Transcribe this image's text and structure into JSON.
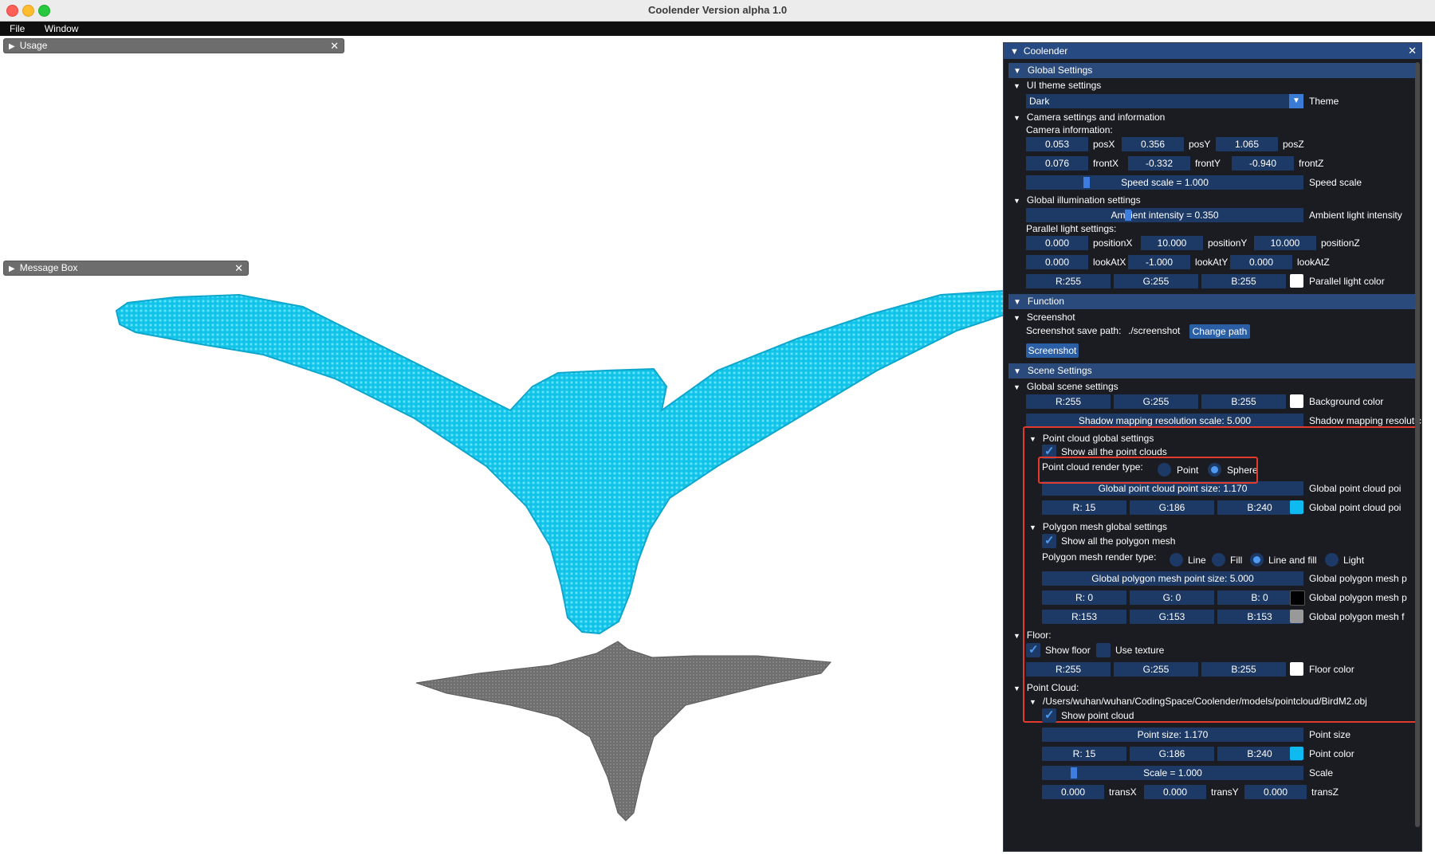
{
  "window": {
    "title": "Coolender Version alpha 1.0"
  },
  "menu": [
    "File",
    "Window"
  ],
  "usage_window": {
    "title": "Usage"
  },
  "message_box": {
    "title": "Message Box"
  },
  "panel": {
    "title": "Coolender",
    "global_settings": {
      "header": "Global Settings",
      "ui_theme": {
        "title": "UI theme settings",
        "value": "Dark",
        "label": "Theme"
      },
      "camera": {
        "title": "Camera settings and information",
        "info_label": "Camera information:",
        "pos": [
          {
            "value": "0.053",
            "label": "posX"
          },
          {
            "value": "0.356",
            "label": "posY"
          },
          {
            "value": "1.065",
            "label": "posZ"
          }
        ],
        "front": [
          {
            "value": "0.076",
            "label": "frontX"
          },
          {
            "value": "-0.332",
            "label": "frontY"
          },
          {
            "value": "-0.940",
            "label": "frontZ"
          }
        ],
        "speed": {
          "value": "Speed scale = 1.000",
          "label": "Speed scale"
        }
      },
      "illumination": {
        "title": "Global illumination settings",
        "ambient": {
          "value": "Ambient intensity = 0.350",
          "label": "Ambient light intensity"
        },
        "parallel_label": "Parallel light settings:",
        "position": [
          {
            "value": "0.000",
            "label": "positionX"
          },
          {
            "value": "10.000",
            "label": "positionY"
          },
          {
            "value": "10.000",
            "label": "positionZ"
          }
        ],
        "lookat": [
          {
            "value": "0.000",
            "label": "lookAtX"
          },
          {
            "value": "-1.000",
            "label": "lookAtY"
          },
          {
            "value": "0.000",
            "label": "lookAtZ"
          }
        ],
        "color": {
          "r": "R:255",
          "g": "G:255",
          "b": "B:255",
          "label": "Parallel light color",
          "swatch": "#ffffff"
        }
      }
    },
    "function": {
      "header": "Function",
      "screenshot_title": "Screenshot",
      "save_path_label": "Screenshot save path:",
      "save_path_value": "./screenshot",
      "change_path": "Change path",
      "screenshot_btn": "Screenshot"
    },
    "scene": {
      "header": "Scene Settings",
      "global_title": "Global scene settings",
      "bg": {
        "r": "R:255",
        "g": "G:255",
        "b": "B:255",
        "label": "Background color",
        "swatch": "#ffffff"
      },
      "shadow": {
        "value": "Shadow mapping resolution scale: 5.000",
        "label": "Shadow mapping resolutic"
      },
      "pc_global": {
        "title": "Point cloud global settings",
        "show_all": "Show all the point clouds",
        "render_type_label": "Point cloud render type:",
        "point": "Point",
        "sphere": "Sphere",
        "size": {
          "value": "Global point cloud point size: 1.170",
          "label": "Global point cloud poi"
        },
        "color": {
          "r": "R: 15",
          "g": "G:186",
          "b": "B:240",
          "label": "Global point cloud poi",
          "swatch": "#0fbaf0"
        }
      },
      "mesh_global": {
        "title": "Polygon mesh global settings",
        "show_all": "Show all the polygon mesh",
        "render_type_label": "Polygon mesh render type:",
        "types": [
          "Line",
          "Fill",
          "Line and fill",
          "Light"
        ],
        "size": {
          "value": "Global polygon mesh point size: 5.000",
          "label": "Global polygon mesh p"
        },
        "color1": {
          "r": "R:  0",
          "g": "G:  0",
          "b": "B:  0",
          "label": "Global polygon mesh p",
          "swatch": "#000000"
        },
        "color2": {
          "r": "R:153",
          "g": "G:153",
          "b": "B:153",
          "label": "Global polygon mesh f",
          "swatch": "#999999"
        }
      },
      "floor": {
        "title": "Floor:",
        "show": "Show floor",
        "texture": "Use texture",
        "color": {
          "r": "R:255",
          "g": "G:255",
          "b": "B:255",
          "label": "Floor color",
          "swatch": "#ffffff"
        }
      },
      "point_cloud": {
        "title": "Point Cloud:",
        "path": "/Users/wuhan/wuhan/CodingSpace/Coolender/models/pointcloud/BirdM2.obj",
        "show": "Show point cloud",
        "size": {
          "value": "Point size: 1.170",
          "label": "Point size"
        },
        "color": {
          "r": "R: 15",
          "g": "G:186",
          "b": "B:240",
          "label": "Point color",
          "swatch": "#0fbaf0"
        },
        "scale": {
          "value": "Scale = 1.000",
          "label": "Scale"
        },
        "trans": [
          {
            "value": "0.000",
            "label": "transX"
          },
          {
            "value": "0.000",
            "label": "transY"
          },
          {
            "value": "0.000",
            "label": "transZ"
          }
        ]
      }
    }
  },
  "colors": {
    "accent": "#294a7a",
    "point_cloud": "#10bde6",
    "shadow": "#707070",
    "highlight": "#e23a2c"
  },
  "icons": [
    "close-icon",
    "triangle-right-icon",
    "triangle-down-icon",
    "checkmark-icon",
    "chevron-down-icon"
  ]
}
